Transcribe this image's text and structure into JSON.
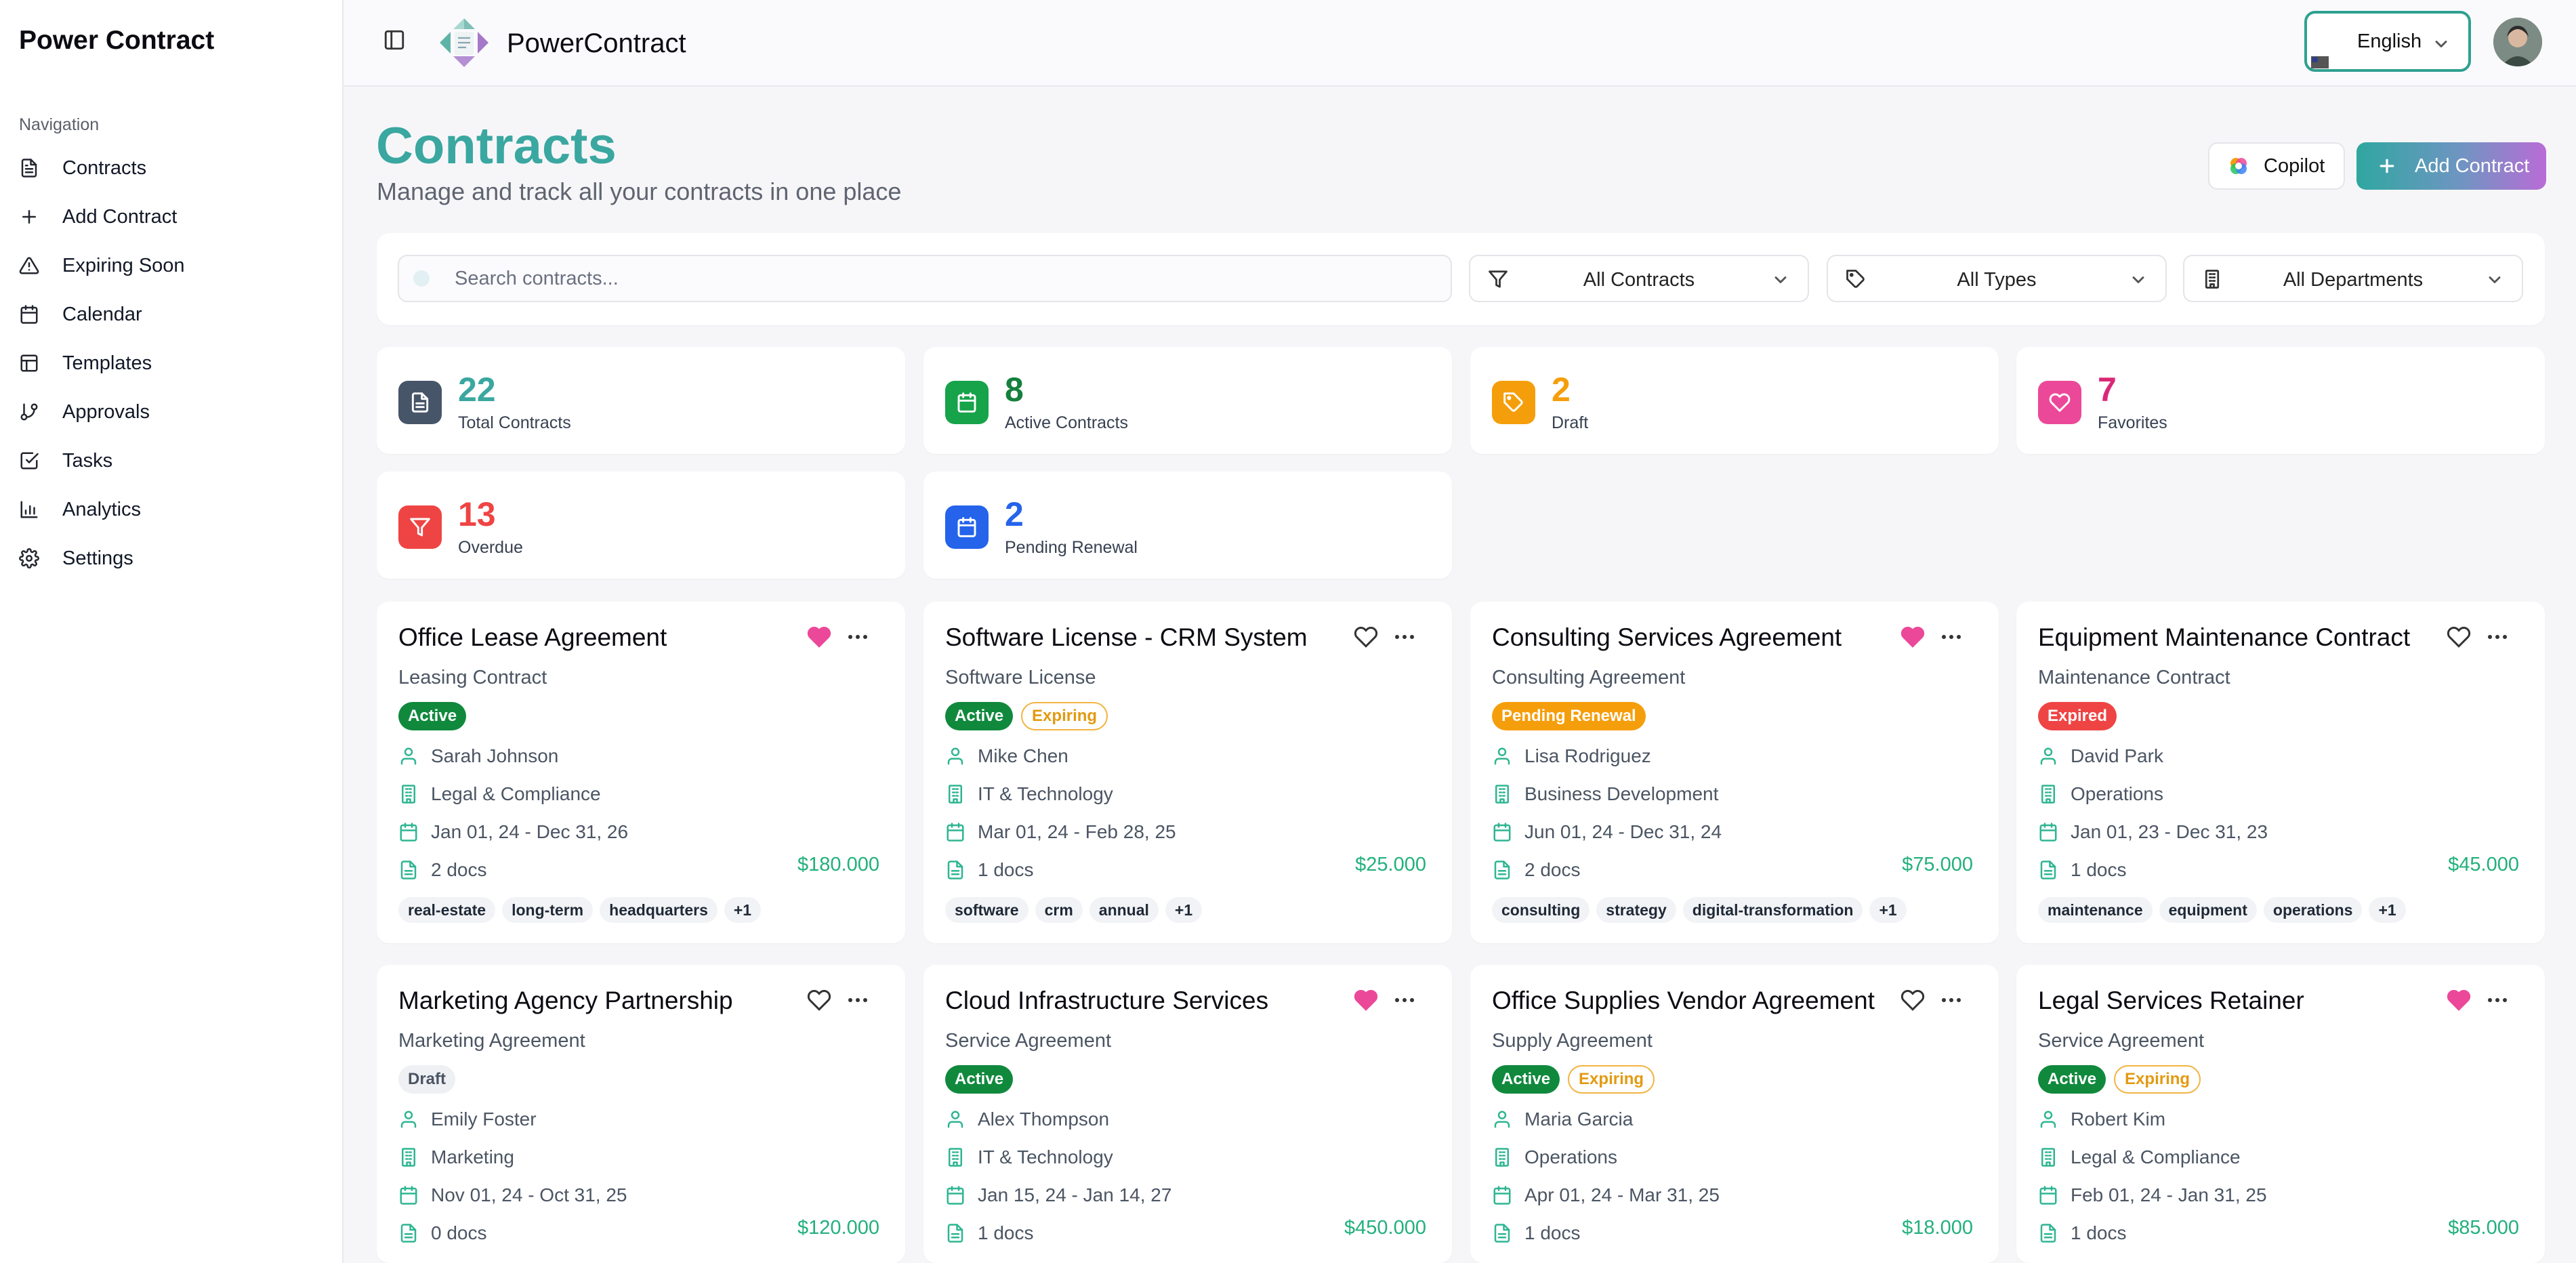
{
  "sidebar": {
    "app_name": "Power Contract",
    "nav_heading": "Navigation",
    "items": [
      {
        "label": "Contracts",
        "icon": "file-text-icon"
      },
      {
        "label": "Add Contract",
        "icon": "plus-icon"
      },
      {
        "label": "Expiring Soon",
        "icon": "alert-triangle-icon"
      },
      {
        "label": "Calendar",
        "icon": "calendar-icon"
      },
      {
        "label": "Templates",
        "icon": "layout-template-icon"
      },
      {
        "label": "Approvals",
        "icon": "git-branch-icon"
      },
      {
        "label": "Tasks",
        "icon": "check-square-icon"
      },
      {
        "label": "Analytics",
        "icon": "bar-chart-icon"
      },
      {
        "label": "Settings",
        "icon": "gear-icon"
      }
    ]
  },
  "topbar": {
    "brand": "PowerContract",
    "language": "English",
    "language_flag": "us-flag-icon"
  },
  "header": {
    "title": "Contracts",
    "subtitle": "Manage and track all your contracts in one place",
    "copilot_label": "Copilot",
    "add_label": "Add Contract"
  },
  "filters": {
    "search_placeholder": "Search contracts...",
    "status": "All Contracts",
    "types": "All Types",
    "departments": "All Departments"
  },
  "stats": [
    {
      "value": "22",
      "label": "Total Contracts",
      "color": "#475569",
      "num_color": "#3aa7a0",
      "icon": "file-text-icon"
    },
    {
      "value": "8",
      "label": "Active Contracts",
      "color": "#16a34a",
      "num_color": "#15803d",
      "icon": "calendar-icon"
    },
    {
      "value": "2",
      "label": "Draft",
      "color": "#f59e0b",
      "num_color": "#f59e0b",
      "icon": "tag-icon"
    },
    {
      "value": "7",
      "label": "Favorites",
      "color": "#ec4899",
      "num_color": "#db2777",
      "icon": "heart-icon"
    },
    {
      "value": "13",
      "label": "Overdue",
      "color": "#ef4444",
      "num_color": "#ef4444",
      "icon": "filter-icon"
    },
    {
      "value": "2",
      "label": "Pending Renewal",
      "color": "#2563eb",
      "num_color": "#2563eb",
      "icon": "calendar-icon"
    }
  ],
  "contracts": [
    {
      "title": "Office Lease Agreement",
      "type": "Leasing Contract",
      "favorite": true,
      "badges": [
        {
          "label": "Active",
          "kind": "active"
        }
      ],
      "owner": "Sarah Johnson",
      "department": "Legal & Compliance",
      "dates": "Jan 01, 24 - Dec 31, 26",
      "docs": "2 docs",
      "value": "$180.000",
      "tags": [
        "real-estate",
        "long-term",
        "headquarters",
        "+1"
      ]
    },
    {
      "title": "Software License - CRM System",
      "type": "Software License",
      "favorite": false,
      "badges": [
        {
          "label": "Active",
          "kind": "active"
        },
        {
          "label": "Expiring",
          "kind": "expiring"
        }
      ],
      "owner": "Mike Chen",
      "department": "IT & Technology",
      "dates": "Mar 01, 24 - Feb 28, 25",
      "docs": "1 docs",
      "value": "$25.000",
      "tags": [
        "software",
        "crm",
        "annual",
        "+1"
      ]
    },
    {
      "title": "Consulting Services Agreement",
      "type": "Consulting Agreement",
      "favorite": true,
      "badges": [
        {
          "label": "Pending Renewal",
          "kind": "pending"
        }
      ],
      "owner": "Lisa Rodriguez",
      "department": "Business Development",
      "dates": "Jun 01, 24 - Dec 31, 24",
      "docs": "2 docs",
      "value": "$75.000",
      "tags": [
        "consulting",
        "strategy",
        "digital-transformation",
        "+1"
      ]
    },
    {
      "title": "Equipment Maintenance Contract",
      "type": "Maintenance Contract",
      "favorite": false,
      "badges": [
        {
          "label": "Expired",
          "kind": "expired"
        }
      ],
      "owner": "David Park",
      "department": "Operations",
      "dates": "Jan 01, 23 - Dec 31, 23",
      "docs": "1 docs",
      "value": "$45.000",
      "tags": [
        "maintenance",
        "equipment",
        "operations",
        "+1"
      ]
    },
    {
      "title": "Marketing Agency Partnership",
      "type": "Marketing Agreement",
      "favorite": false,
      "badges": [
        {
          "label": "Draft",
          "kind": "draft"
        }
      ],
      "owner": "Emily Foster",
      "department": "Marketing",
      "dates": "Nov 01, 24 - Oct 31, 25",
      "docs": "0 docs",
      "value": "$120.000",
      "tags": []
    },
    {
      "title": "Cloud Infrastructure Services",
      "type": "Service Agreement",
      "favorite": true,
      "badges": [
        {
          "label": "Active",
          "kind": "active"
        }
      ],
      "owner": "Alex Thompson",
      "department": "IT & Technology",
      "dates": "Jan 15, 24 - Jan 14, 27",
      "docs": "1 docs",
      "value": "$450.000",
      "tags": []
    },
    {
      "title": "Office Supplies Vendor Agreement",
      "type": "Supply Agreement",
      "favorite": false,
      "badges": [
        {
          "label": "Active",
          "kind": "active"
        },
        {
          "label": "Expiring",
          "kind": "expiring"
        }
      ],
      "owner": "Maria Garcia",
      "department": "Operations",
      "dates": "Apr 01, 24 - Mar 31, 25",
      "docs": "1 docs",
      "value": "$18.000",
      "tags": []
    },
    {
      "title": "Legal Services Retainer",
      "type": "Service Agreement",
      "favorite": true,
      "badges": [
        {
          "label": "Active",
          "kind": "active"
        },
        {
          "label": "Expiring",
          "kind": "expiring"
        }
      ],
      "owner": "Robert Kim",
      "department": "Legal & Compliance",
      "dates": "Feb 01, 24 - Jan 31, 25",
      "docs": "1 docs",
      "value": "$85.000",
      "tags": []
    }
  ],
  "colors": {
    "accent": "#3aa7a0",
    "heart_active": "#ec4899",
    "meta_icon": "#2fb592",
    "price": "#22b07d"
  }
}
